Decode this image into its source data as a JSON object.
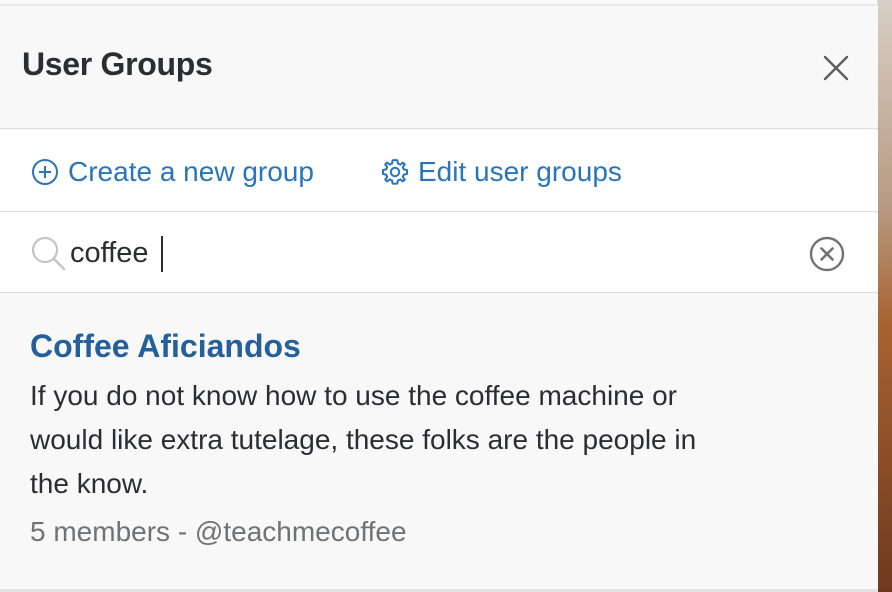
{
  "header": {
    "title": "User Groups",
    "close_icon": "close-icon"
  },
  "actions": {
    "create_label": "Create a new group",
    "create_icon": "plus-circle-icon",
    "edit_label": "Edit user groups",
    "edit_icon": "gear-icon"
  },
  "search": {
    "value": "coffee",
    "icon": "search-icon",
    "clear_icon": "clear-circle-icon"
  },
  "results": [
    {
      "name": "Coffee Aficiandos",
      "description": "If you do not know how to use the coffee machine or would like extra tutelage, these folks are the people in the know.",
      "meta": "5 members - @teachmecoffee"
    }
  ],
  "colors": {
    "link": "#2a75b9",
    "group_name": "#24609a",
    "text": "#2c2d30",
    "muted": "#717274"
  }
}
